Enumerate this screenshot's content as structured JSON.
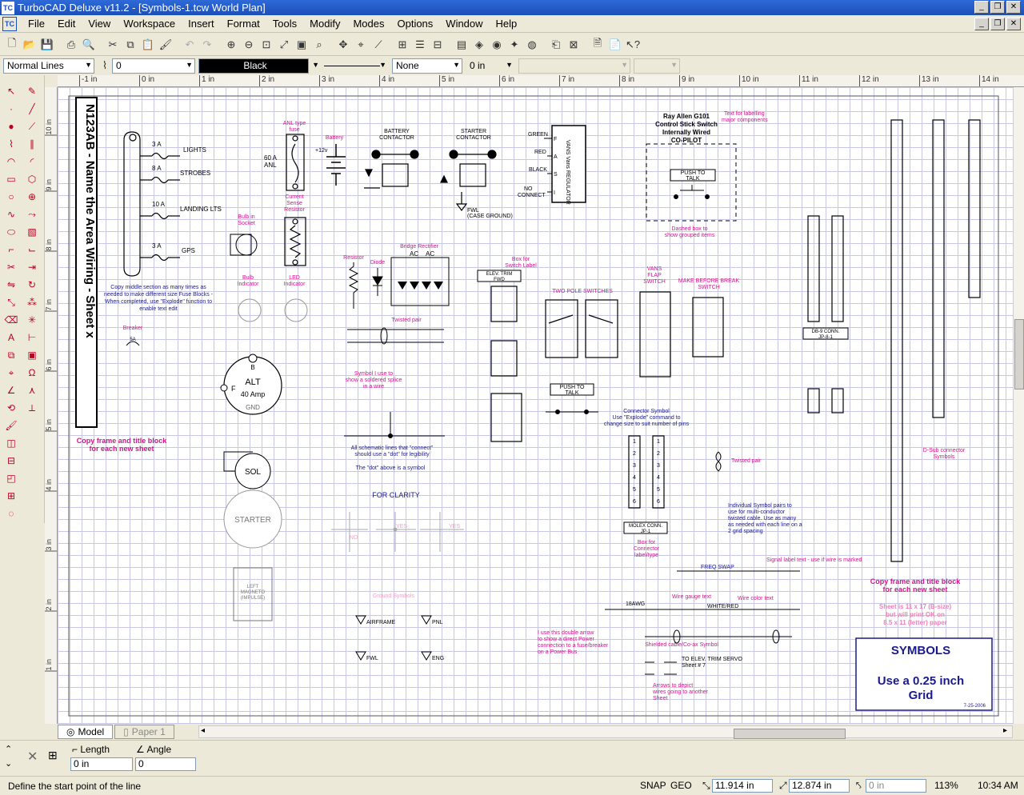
{
  "window": {
    "title": "TurboCAD Deluxe v11.2 - [Symbols-1.tcw World Plan]",
    "app_icon": "TC"
  },
  "menu": [
    "File",
    "Edit",
    "View",
    "Workspace",
    "Insert",
    "Format",
    "Tools",
    "Modify",
    "Modes",
    "Options",
    "Window",
    "Help"
  ],
  "properties": {
    "line_style": "Normal Lines",
    "line_width": "0",
    "color": "Black",
    "fill": "None",
    "offset": "0 in"
  },
  "ruler_h": [
    "-1 in",
    "0 in",
    "1 in",
    "2 in",
    "3 in",
    "4 in",
    "5 in",
    "6 in",
    "7 in",
    "8 in",
    "9 in",
    "10 in",
    "11 in",
    "12 in",
    "13 in",
    "14 in"
  ],
  "ruler_v": [
    "10 in",
    "9 in",
    "8 in",
    "7 in",
    "6 in",
    "5 in",
    "4 in",
    "3 in",
    "2 in",
    "1 in"
  ],
  "drawing": {
    "title_block": "N123AB - Name the Area Wiring - Sheet x",
    "copy_frame_left": "Copy frame and title block for each new sheet",
    "copy_frame_right": "Copy frame and title block for each new sheet",
    "sheet_note": "Sheet is 11 x 17 (B-size) but will print OK on 8.5 x 11 (letter) paper",
    "symbols_box_title": "SYMBOLS",
    "symbols_box_line1": "Use a 0.25 inch",
    "symbols_box_line2": "Grid",
    "symbols_box_date": "7-25-2006",
    "fuse_labels": [
      "3 A",
      "8 A",
      "10 A",
      "3 A"
    ],
    "fuse_loads": [
      "LIGHTS",
      "STROBES",
      "LANDING LTS",
      "GPS"
    ],
    "fuse_note": "Copy middle section as many times as needed to make different size Fuse Blocks - When completed, use \"Explode\" function to enable text edit",
    "anl_fuse": "ANL type fuse",
    "anl_value": "60 A ANL",
    "battery": "Battery",
    "battery_volts": "+12v",
    "battery_contactor": "BATTERY CONTACTOR",
    "starter_contactor": "STARTER CONTACTOR",
    "case_ground": "FWL (CASE GROUND)",
    "regulator": "VANS Vans REGULATOR",
    "reg_pins": [
      "GREEN",
      "RED",
      "BLACK",
      "NO CONNECT"
    ],
    "reg_letters": [
      "F",
      "A",
      "S",
      "I"
    ],
    "control_stick": "Ray Allen G101 Control Stick Switch Internally Wired CO-PILOT",
    "text_labelling": "Text for labelling major components",
    "push_to_talk": "PUSH TO TALK",
    "dashed_box_note": "Dashed box to show grouped items",
    "bulb_socket": "Bulb in Socket",
    "current_sense": "Current Sense Resistor",
    "resistor": "Resistor",
    "diode": "Diode",
    "bridge_rectifier": "Bridge Rectifier",
    "bridge_ac": [
      "AC",
      "AC"
    ],
    "bulb_indicator": "Bulb Indicator",
    "led_indicator": "LED Indicator",
    "breaker": "Breaker",
    "breaker_value": "5A",
    "twisted_pair_1": "Twisted pair",
    "solder_splice": "Symbol I use to show a soldered splice in a wire",
    "connect_note": "All schematic lines that \"connect\" should use a \"dot\" for legibility",
    "dot_note": "The \"dot\" above is a symbol",
    "for_clarity": "FOR CLARITY",
    "clarity_labels": [
      "NO",
      "YES",
      "YES"
    ],
    "alternator": "ALT",
    "alternator_amp": "40 Amp",
    "alt_b": "B",
    "alt_f": "F",
    "alt_gnd": "GND",
    "solenoid": "SOL",
    "starter": "STARTER",
    "magneto": "LEFT MAGNETO (IMPULSE)",
    "ground_symbols": "Ground Symbols",
    "grounds": [
      "AIRFRAME",
      "PNL",
      "FWL",
      "ENG"
    ],
    "box_switch_label": "Box for Switch Label",
    "elev_trim": "ELEV. TRIM FWD",
    "two_pole": "TWO POLE SWITCHES",
    "vans_flap": "VANS FLAP SWITCH",
    "make_before_break": "MAKE BEFORE BREAK SWITCH",
    "push_to_talk_2": "PUSH TO TALK",
    "connector_symbol": "Connector Symbol Use \"Explode\" command to change size to suit number of pins",
    "molex": "MOLEX CONN. JP-1",
    "box_connector": "Box for Connector label/type",
    "db9_conn": "DB-9 CONN. JP-8-1",
    "dsub": "D-Sub connector Symbols",
    "twisted_pair_2": "Twisted pair",
    "individual_symbol": "Individual Symbol pairs to use for multi-conductor twisted cable. Use as many as needed with each line on a 2 grid spacing",
    "signal_label": "Signal label text - use if wire is marked",
    "freq_swap": "FREQ SWAP",
    "wire_gauge": "Wire gauge text",
    "awg": "18AWG",
    "white_red": "WHITE/RED",
    "wire_color": "Wire color text",
    "double_arrow": "I use this double arrow to show a direct Power connection to a fuse/breaker on a Power Bus",
    "shielded": "Shielded cable/Co-ax Symbol",
    "elev_trim_servo": "TO ELEV. TRIM SERVO Sheet # 7",
    "arrows_note": "Arrows to depict wires going to another Sheet"
  },
  "tabs": [
    "Model",
    "Paper 1"
  ],
  "input": {
    "length_label": "Length",
    "length_value": "0 in",
    "angle_label": "Angle",
    "angle_value": "0"
  },
  "status": {
    "message": "Define the start point of the line",
    "snap": "SNAP",
    "geo": "GEO",
    "x": "11.914 in",
    "y": "12.874 in",
    "z": "0 in",
    "zoom": "113%",
    "time": "10:34 AM"
  },
  "colors": {
    "titlebar": "#1c4fb7",
    "magenta_text": "#d4148c",
    "navy_text": "#1a1a8c",
    "grid": "#c8c8e6"
  }
}
